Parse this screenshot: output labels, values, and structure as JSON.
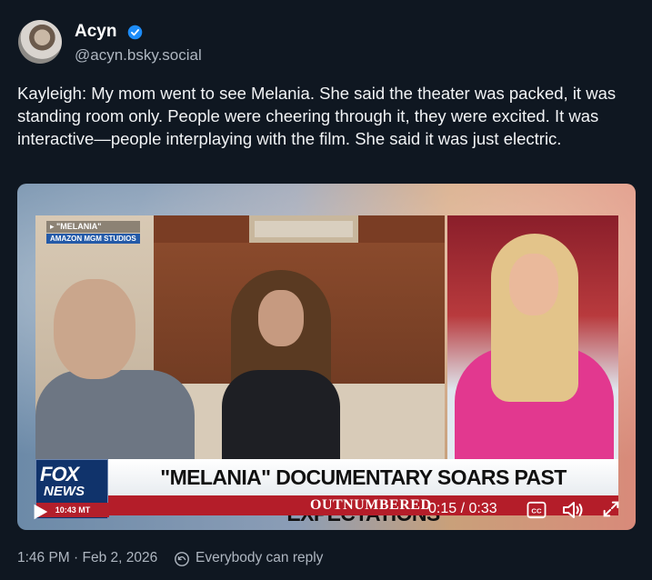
{
  "author": {
    "display_name": "Acyn",
    "handle": "@acyn.bsky.social",
    "verified": true,
    "verified_color": "#1d8cf8"
  },
  "post": {
    "text": "Kayleigh: My mom went to see Melania. She said the theater was packed, it was standing room only. People were cheering through it, they were excited. It was interactive—people interplaying with the film. She said it was just electric.",
    "timestamp": "1:46 PM · Feb 2, 2026",
    "reply_setting": "Everybody can reply"
  },
  "video": {
    "doc_tag_title": "▸ \"MELANIA\"",
    "doc_tag_studio": "AMAZON MGM STUDIOS",
    "network_logo": "FOX",
    "network_logo_sub": "NEWS",
    "clock": "10:43 MT",
    "headline": "\"MELANIA\" DOCUMENTARY SOARS PAST EXPECTATIONS",
    "show_name": "OUTNUMBERED",
    "time_display": "0:15 / 0:33",
    "progress": 0.4545,
    "controls": {
      "play": "play-icon",
      "captions": "cc-icon",
      "volume": "volume-icon",
      "fullscreen": "fullscreen-icon"
    }
  },
  "colors": {
    "background": "#0f1721",
    "secondary_text": "#aeb6c0",
    "fox_red": "#b41d29",
    "fox_blue": "#10336b"
  }
}
